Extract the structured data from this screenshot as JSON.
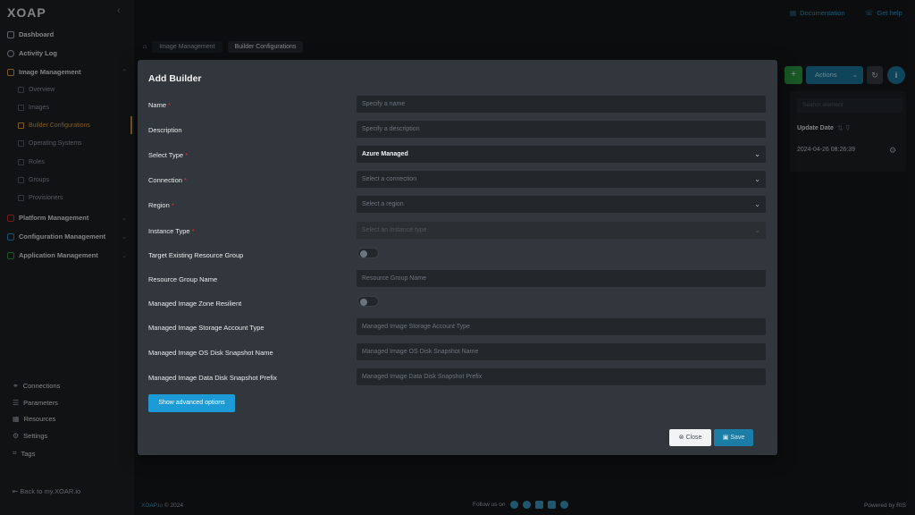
{
  "sidebar": {
    "logo": "XOAP",
    "items": [
      {
        "label": "Dashboard"
      },
      {
        "label": "Activity Log"
      },
      {
        "label": "Image Management"
      },
      {
        "label": "Platform Management"
      },
      {
        "label": "Configuration Management"
      },
      {
        "label": "Application Management"
      }
    ],
    "sub_items": [
      {
        "label": "Overview"
      },
      {
        "label": "Images"
      },
      {
        "label": "Builder Configurations"
      },
      {
        "label": "Operating Systems"
      },
      {
        "label": "Roles"
      },
      {
        "label": "Groups"
      },
      {
        "label": "Provisioners"
      }
    ],
    "bottom_items": [
      {
        "label": "Connections"
      },
      {
        "label": "Parameters"
      },
      {
        "label": "Resources"
      },
      {
        "label": "Settings"
      },
      {
        "label": "Tags"
      }
    ],
    "back_link": "Back to my.XOAR.io"
  },
  "header": {
    "documentation": "Documentation",
    "get_help": "Get help",
    "breadcrumb": [
      "Image Management",
      "Builder Configurations"
    ]
  },
  "toolbar": {
    "add": "+",
    "actions": "Actions",
    "refresh": "↻",
    "info": "i"
  },
  "background_table": {
    "search_placeholder": "Search element",
    "column": "Update Date",
    "row_date": "2024-04-26 08:26:39"
  },
  "modal": {
    "title": "Add Builder",
    "fields": [
      {
        "label": "Name",
        "required": "*",
        "placeholder": "Specify a name",
        "value": ""
      },
      {
        "label": "Description",
        "required": "",
        "placeholder": "Specify a description",
        "value": ""
      },
      {
        "label": "Select Type",
        "required": "*",
        "placeholder": "",
        "value": "Azure Managed"
      },
      {
        "label": "Connection",
        "required": "*",
        "placeholder": "Select a connection",
        "value": ""
      },
      {
        "label": "Region",
        "required": "*",
        "placeholder": "Select a region",
        "value": ""
      },
      {
        "label": "Instance Type",
        "required": "*",
        "placeholder": "Select an instance type",
        "value": ""
      },
      {
        "label": "Target Existing Resource Group",
        "required": "",
        "placeholder": "",
        "value": ""
      },
      {
        "label": "Resource Group Name",
        "required": "",
        "placeholder": "Resource Group Name",
        "value": ""
      },
      {
        "label": "Managed Image Zone Resilient",
        "required": "",
        "placeholder": "",
        "value": ""
      },
      {
        "label": "Managed Image Storage Account Type",
        "required": "",
        "placeholder": "Managed Image Storage Account Type",
        "value": ""
      },
      {
        "label": "Managed Image OS Disk Snapshot Name",
        "required": "",
        "placeholder": "Managed Image OS Disk Snapshot Name",
        "value": ""
      },
      {
        "label": "Managed Image Data Disk Snapshot Prefix",
        "required": "",
        "placeholder": "Managed Image Data Disk Snapshot Prefix",
        "value": ""
      }
    ],
    "advanced_button": "Show advanced options",
    "close_button": "Close",
    "save_button": "Save"
  },
  "footer": {
    "brand": "XOAP.io",
    "copyright": "© 2024",
    "follow": "Follow us on",
    "powered": "Powered by RIS"
  },
  "colors": {
    "accent": "#1c9ad6",
    "active_nav": "#e8a23a",
    "required": "#e03131"
  }
}
